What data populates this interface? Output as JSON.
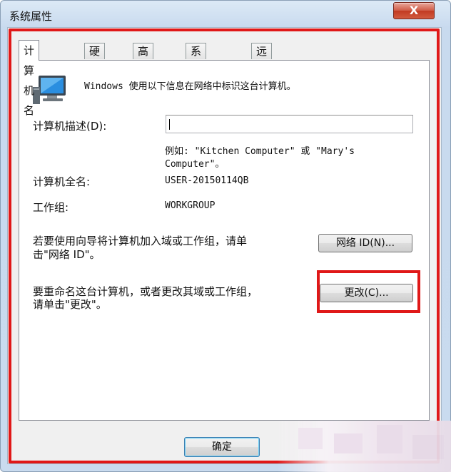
{
  "window": {
    "title": "系统属性",
    "close_label": "X"
  },
  "tabs": [
    {
      "label": "计算机名",
      "active": true
    },
    {
      "label": "硬件",
      "active": false
    },
    {
      "label": "高级",
      "active": false
    },
    {
      "label": "系统保护",
      "active": false
    },
    {
      "label": "远程",
      "active": false
    }
  ],
  "content": {
    "intro": "Windows 使用以下信息在网络中标识这台计算机。",
    "description_label": "计算机描述(D):",
    "description_value": "",
    "example_line1": "例如: \"Kitchen Computer\" 或 \"Mary's",
    "example_line2": "Computer\"。",
    "fullname_label": "计算机全名:",
    "fullname_value": "USER-20150114QB",
    "workgroup_label": "工作组:",
    "workgroup_value": "WORKGROUP",
    "wizard_text_line1": "若要使用向导将计算机加入域或工作组，请单",
    "wizard_text_line2": "击\"网络 ID\"。",
    "network_id_button": "网络 ID(N)...",
    "rename_text_line1": "要重命名这台计算机，或者更改其域或工作组，",
    "rename_text_line2": "请单击\"更改\"。",
    "change_button": "更改(C)..."
  },
  "footer": {
    "ok_button": "确定"
  },
  "colors": {
    "highlight": "#e01818",
    "window_frame": "#c9dbef",
    "close_button": "#c13a22"
  },
  "icons": [
    "computer-monitor-icon",
    "close-icon"
  ]
}
